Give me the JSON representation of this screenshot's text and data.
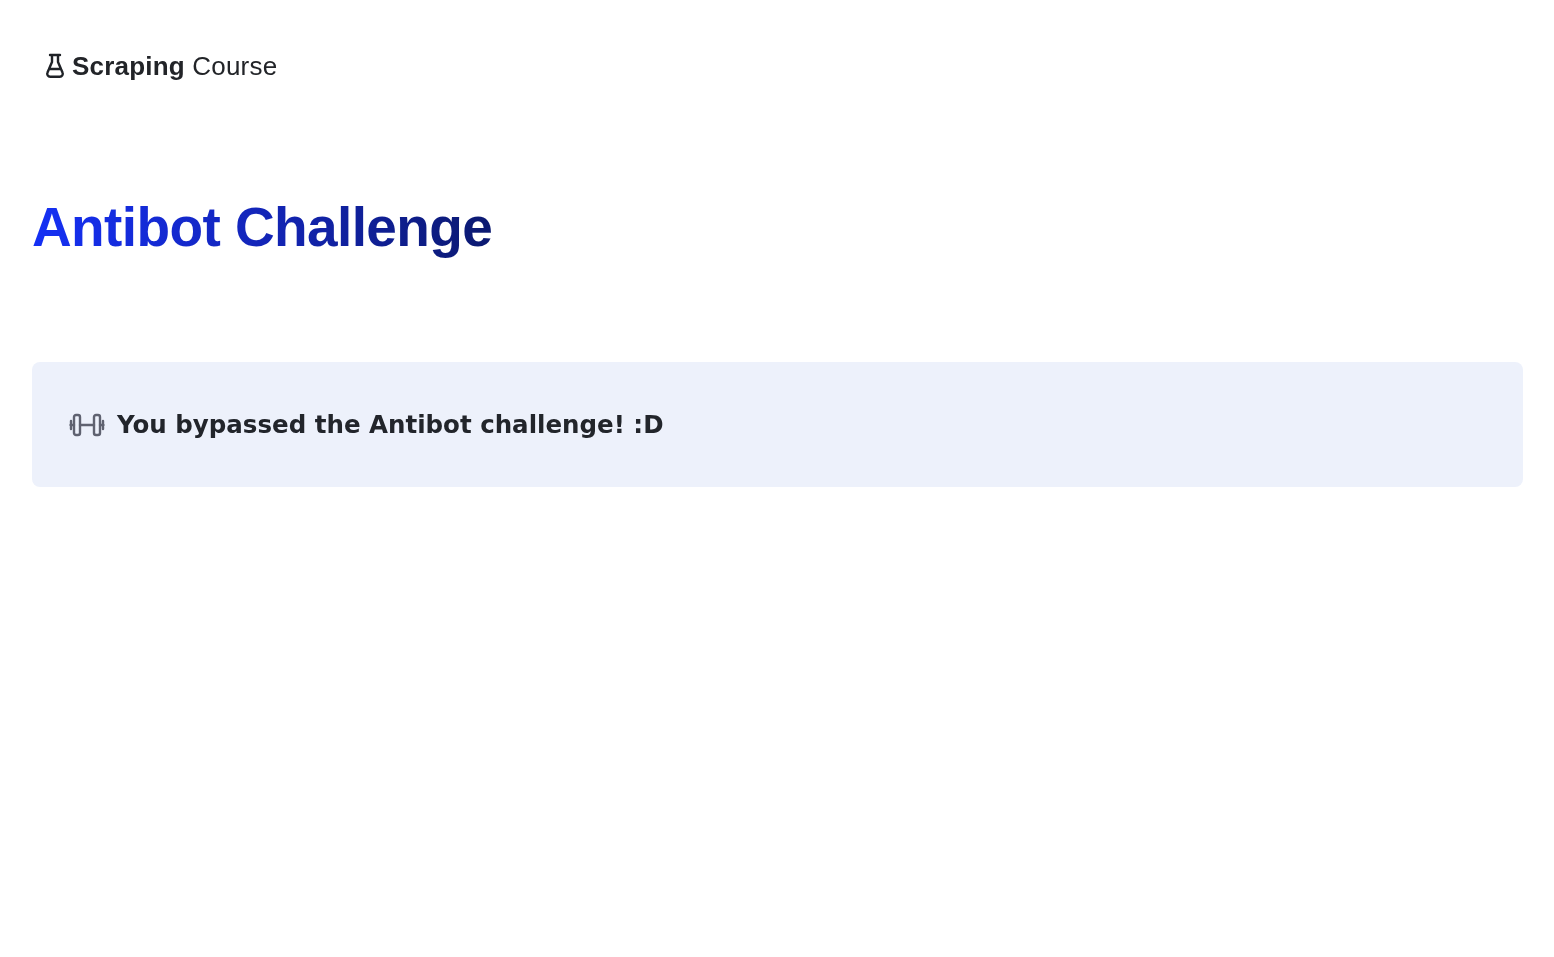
{
  "header": {
    "logo": "**Scraping** Course"
  },
  "page": {
    "title": "Antibot Challenge"
  },
  "alert": {
    "message": "You bypassed the Antibot challenge! :D"
  }
}
